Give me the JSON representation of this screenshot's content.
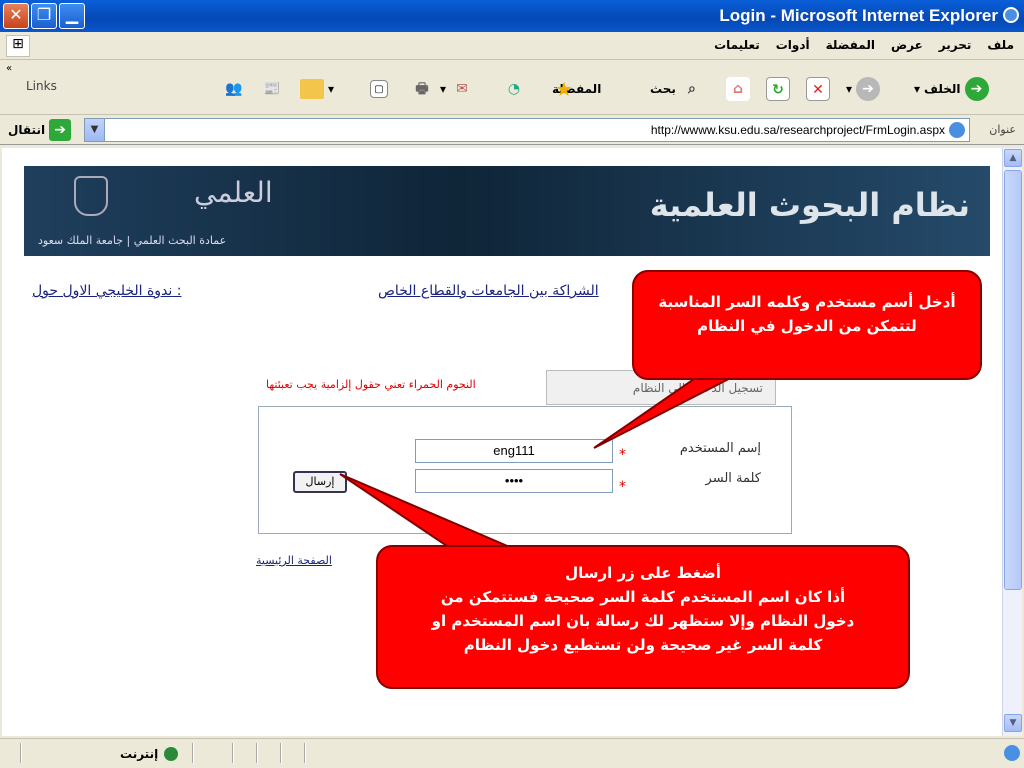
{
  "window": {
    "title": "Login - Microsoft Internet Explorer"
  },
  "menu": {
    "items": [
      "ملف",
      "تحرير",
      "عرض",
      "المفضلة",
      "أدوات",
      "تعليمات"
    ]
  },
  "toolbar": {
    "back_label": "الخلف",
    "search_label": "بحث",
    "favorites_label": "المفضلة",
    "links_label": "Links"
  },
  "address": {
    "label": "عنوان",
    "url": "http://wwww.ksu.edu.sa/researchproject/FrmLogin.aspx",
    "go_label": "انتقال"
  },
  "banner": {
    "title": "نظام البحوث العلمية",
    "logo_text": "العلمي",
    "subtitle": "عمادة البحث العلمي | جامعة الملك سعود"
  },
  "nav": {
    "link_left": "ندوة الخليجي الاول حول :",
    "link_middle": "الشراكة بين الجامعات والقطاع الخاص"
  },
  "login": {
    "tab_label": "تسجيل الدخول الى النظام",
    "required_note": "النجوم الحمراء تعني حقول إلزامية يجب تعبئتها",
    "username_label": "إسم المستخدم",
    "username_value": "eng111",
    "password_label": "كلمة السر",
    "password_value": "••••",
    "required_star": "*",
    "submit_label": "إرسال",
    "home_link": "الصفحة الرئيسية"
  },
  "callouts": {
    "first": "أدخل أسم مستخدم وكلمه السر المناسبة لتتمكن من الدخول في النظام",
    "second_line1": "أضغط على زر ارسال",
    "second_line2": "أذا كان اسم المستخدم كلمة السر صحيحة فستتمكن من",
    "second_line3": "دخول النظام وإلا ستظهر لك رسالة   بان اسم المستخدم او",
    "second_line4": "كلمة السر غير صحيحة ولن تستطيع دخول النظام"
  },
  "status": {
    "zone": "إنترنت"
  },
  "colors": {
    "titlebar": "#0548b5",
    "callout": "#ff0000",
    "required": "#dd0000",
    "banner": "#0f2538"
  }
}
